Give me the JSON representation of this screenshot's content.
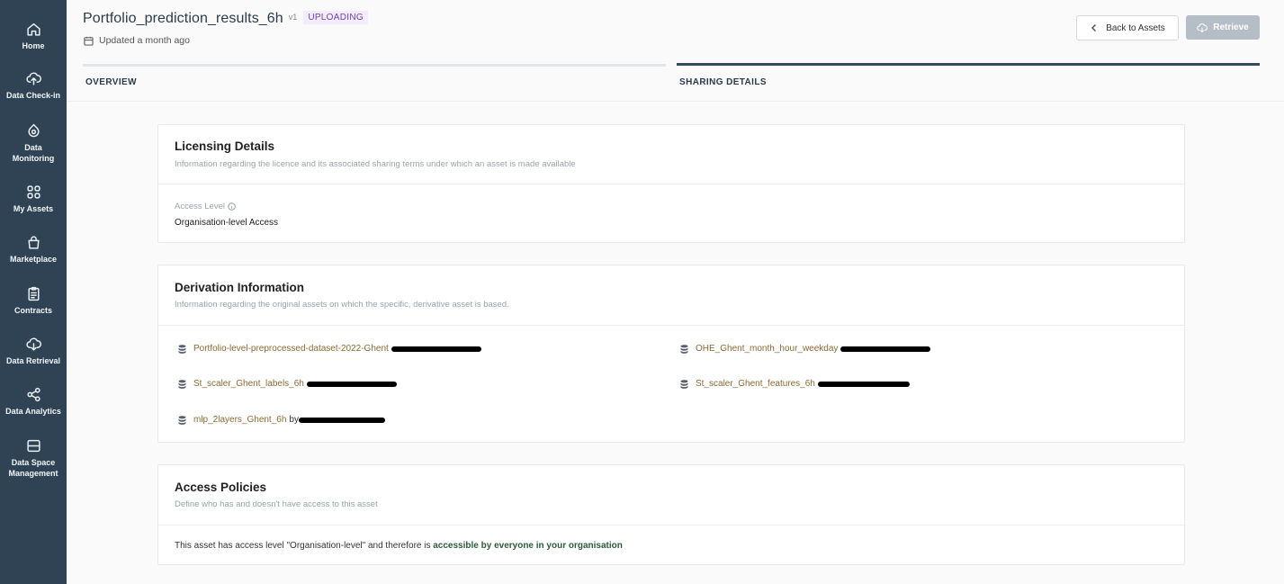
{
  "sidebar": {
    "items": [
      {
        "label": "Home",
        "icon": "home-icon"
      },
      {
        "label": "Data Check-in",
        "icon": "upload-cloud-icon"
      },
      {
        "label": "Data Monitoring",
        "icon": "monitoring-icon"
      },
      {
        "label": "My Assets",
        "icon": "grid-icon"
      },
      {
        "label": "Marketplace",
        "icon": "shopping-bag-icon"
      },
      {
        "label": "Contracts",
        "icon": "clipboard-icon"
      },
      {
        "label": "Data Retrieval",
        "icon": "download-cloud-icon"
      },
      {
        "label": "Data Analytics",
        "icon": "share-nodes-icon"
      },
      {
        "label": "Data Space Management",
        "icon": "database-panel-icon"
      }
    ]
  },
  "header": {
    "title": "Portfolio_prediction_results_6h",
    "version": "v1",
    "status": "UPLOADING",
    "updated": "Updated a month ago",
    "back_label": "Back to Assets",
    "retrieve_label": "Retrieve"
  },
  "tabs": [
    {
      "label": "OVERVIEW",
      "active": false
    },
    {
      "label": "SHARING DETAILS",
      "active": true
    }
  ],
  "licensing": {
    "title": "Licensing Details",
    "subtitle": "Information regarding the licence and its associated sharing terms under which an asset is made available",
    "access_label": "Access Level",
    "access_value": "Organisation-level Access"
  },
  "derivation": {
    "title": "Derivation Information",
    "subtitle": "Information regarding the original assets on which the specific, derivative asset is based.",
    "assets": [
      {
        "name": "Portfolio-level-preprocessed-dataset-2022-Ghent",
        "by": ""
      },
      {
        "name": "OHE_Ghent_month_hour_weekday",
        "by": ""
      },
      {
        "name": "St_scaler_Ghent_labels_6h",
        "by": ""
      },
      {
        "name": "St_scaler_Ghent_features_6h",
        "by": ""
      },
      {
        "name": "mlp_2layers_Ghent_6h",
        "by": "by"
      }
    ]
  },
  "policies": {
    "title": "Access Policies",
    "subtitle": "Define who has and doesn't have access to this asset",
    "text_prefix": "This asset has access level \"Organisation-level\" and therefore is",
    "text_bold": "accessible by everyone in your organisation"
  },
  "colors": {
    "sidebar_bg": "#2f4354",
    "active_tab": "#2f4d5c",
    "asset_link": "#8a6a32",
    "status_badge": "#6b3fb8",
    "policy_bold": "#2c5a3b"
  }
}
